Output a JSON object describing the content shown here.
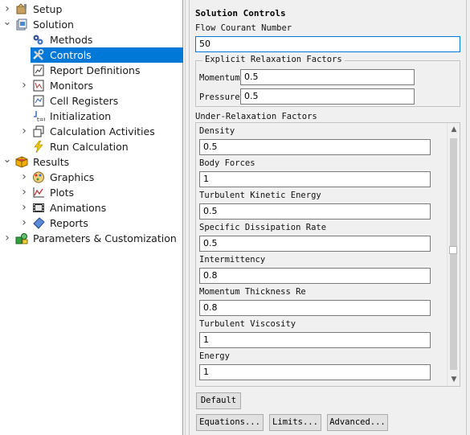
{
  "tree": {
    "items": [
      {
        "label": "Setup",
        "icon": "setup-icon",
        "level": 0,
        "expander": "collapsed"
      },
      {
        "label": "Solution",
        "icon": "solution-icon",
        "level": 0,
        "expander": "expanded"
      },
      {
        "label": "Methods",
        "icon": "methods-icon",
        "level": 1,
        "expander": "none"
      },
      {
        "label": "Controls",
        "icon": "controls-icon",
        "level": 1,
        "expander": "none",
        "selected": true
      },
      {
        "label": "Report Definitions",
        "icon": "report-definitions-icon",
        "level": 1,
        "expander": "none"
      },
      {
        "label": "Monitors",
        "icon": "monitors-icon",
        "level": 1,
        "expander": "collapsed"
      },
      {
        "label": "Cell Registers",
        "icon": "cell-registers-icon",
        "level": 1,
        "expander": "none"
      },
      {
        "label": "Initialization",
        "icon": "initialization-icon",
        "level": 1,
        "expander": "none"
      },
      {
        "label": "Calculation Activities",
        "icon": "calculation-activities-icon",
        "level": 1,
        "expander": "collapsed"
      },
      {
        "label": "Run Calculation",
        "icon": "run-calculation-icon",
        "level": 1,
        "expander": "none"
      },
      {
        "label": "Results",
        "icon": "results-icon",
        "level": 0,
        "expander": "expanded"
      },
      {
        "label": "Graphics",
        "icon": "graphics-icon",
        "level": 1,
        "expander": "collapsed"
      },
      {
        "label": "Plots",
        "icon": "plots-icon",
        "level": 1,
        "expander": "collapsed"
      },
      {
        "label": "Animations",
        "icon": "animations-icon",
        "level": 1,
        "expander": "collapsed"
      },
      {
        "label": "Reports",
        "icon": "reports-icon",
        "level": 1,
        "expander": "collapsed"
      },
      {
        "label": "Parameters & Customization",
        "icon": "parameters-icon",
        "level": 0,
        "expander": "collapsed"
      }
    ],
    "selection_color": "#0078d7"
  },
  "panel": {
    "title": "Solution Controls",
    "flow_courant_label": "Flow Courant Number",
    "flow_courant_value": "50",
    "explicit_group_title": "Explicit Relaxation Factors",
    "momentum_label": "Momentum",
    "momentum_value": "0.5",
    "pressure_label": "Pressure",
    "pressure_value": "0.5",
    "urf_group_title": "Under-Relaxation Factors",
    "urf_items": [
      {
        "label": "Density",
        "value": "0.5"
      },
      {
        "label": "Body Forces",
        "value": "1"
      },
      {
        "label": "Turbulent Kinetic Energy",
        "value": "0.5"
      },
      {
        "label": "Specific Dissipation Rate",
        "value": "0.5"
      },
      {
        "label": "Intermittency",
        "value": "0.8"
      },
      {
        "label": "Momentum Thickness Re",
        "value": "0.8"
      },
      {
        "label": "Turbulent Viscosity",
        "value": "1"
      },
      {
        "label": "Energy",
        "value": "1"
      }
    ],
    "buttons": {
      "default": "Default",
      "equations": "Equations...",
      "limits": "Limits...",
      "advanced": "Advanced..."
    }
  }
}
